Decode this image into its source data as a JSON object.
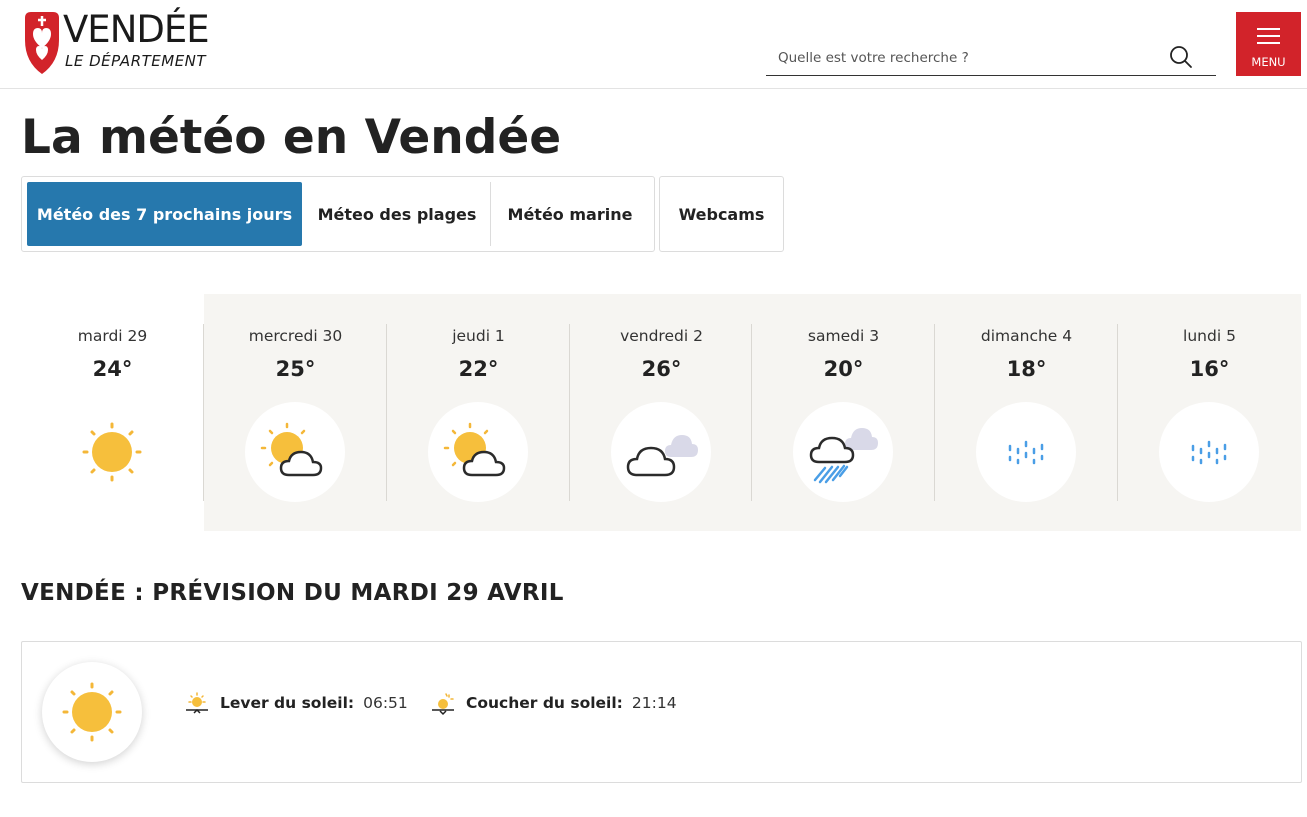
{
  "header": {
    "logo_main": "VENDÉE",
    "logo_sub": "LE DÉPARTEMENT",
    "search_placeholder": "Quelle est votre recherche ?",
    "menu_label": "MENU",
    "brand_color": "#d2232a"
  },
  "page_title": "La météo en Vendée",
  "tabs": [
    {
      "label": "Météo des 7 prochains jours",
      "active": true
    },
    {
      "label": "Méteo des plages",
      "active": false
    },
    {
      "label": "Météo marine",
      "active": false
    },
    {
      "label": "Webcams",
      "active": false
    }
  ],
  "accent_color": "#2678ad",
  "forecast": [
    {
      "day": "mardi 29",
      "temp": "24°",
      "icon": "sun-icon",
      "selected": true
    },
    {
      "day": "mercredi 30",
      "temp": "25°",
      "icon": "sun-cloud-icon"
    },
    {
      "day": "jeudi 1",
      "temp": "22°",
      "icon": "sun-cloud-icon"
    },
    {
      "day": "vendredi 2",
      "temp": "26°",
      "icon": "cloudy-icon"
    },
    {
      "day": "samedi 3",
      "temp": "20°",
      "icon": "heavy-rain-icon"
    },
    {
      "day": "dimanche 4",
      "temp": "18°",
      "icon": "drizzle-icon"
    },
    {
      "day": "lundi 5",
      "temp": "16°",
      "icon": "drizzle-icon"
    }
  ],
  "detail": {
    "title": "VENDÉE : PRÉVISION DU MARDI 29 AVRIL",
    "icon": "sun-icon",
    "sunrise_label": "Lever du soleil:",
    "sunrise_value": "06:51",
    "sunset_label": "Coucher du soleil:",
    "sunset_value": "21:14"
  }
}
